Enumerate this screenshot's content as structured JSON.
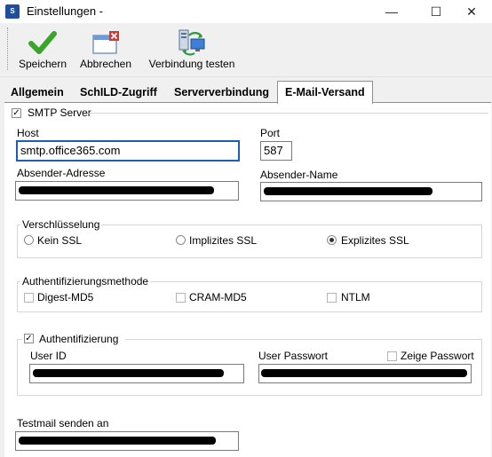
{
  "window": {
    "title": "Einstellungen -",
    "app_icon": "app-icon",
    "minimize": "—",
    "maximize": "☐",
    "close": "✕"
  },
  "toolbar": {
    "save_label": "Speichern",
    "cancel_label": "Abbrechen",
    "test_label": "Verbindung testen"
  },
  "tabs": [
    "Allgemein",
    "SchILD-Zugriff",
    "Serververbindung",
    "E-Mail-Versand"
  ],
  "active_tab": "E-Mail-Versand",
  "smtp": {
    "group_label": "SMTP Server",
    "enabled": true,
    "host_label": "Host",
    "host_value": "smtp.office365.com",
    "port_label": "Port",
    "port_value": "587",
    "sender_address_label": "Absender-Adresse",
    "sender_name_label": "Absender-Name"
  },
  "encryption": {
    "label": "Verschlüsselung",
    "options": [
      "Kein SSL",
      "Implizites SSL",
      "Explizites SSL"
    ],
    "selected": "Explizites SSL"
  },
  "auth_method": {
    "label": "Authentifizierungsmethode",
    "options": [
      "Digest-MD5",
      "CRAM-MD5",
      "NTLM"
    ]
  },
  "auth": {
    "label": "Authentifizierung",
    "enabled": true,
    "user_id_label": "User ID",
    "password_label": "User Passwort",
    "show_password_label": "Zeige Passwort"
  },
  "test_mail": {
    "label": "Testmail senden an"
  },
  "colors": {
    "accent": "#1c5fb4",
    "tab_border": "#8f8f8f",
    "panel": "#ffffff",
    "chrome": "#f0f0f0"
  }
}
